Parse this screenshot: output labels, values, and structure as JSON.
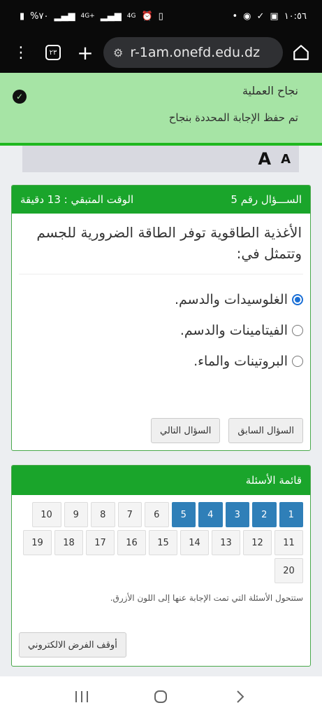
{
  "status_bar": {
    "left": "%٧٠",
    "time": "١٠:٥٦",
    "net1": "4G+",
    "net2": "4G"
  },
  "browser": {
    "tab_count": "٢٣",
    "url": "r-1am.onefd.edu.dz"
  },
  "toast": {
    "title": "نجاح العملية",
    "message": "تم حفظ الإجابة المحددة بنجاح"
  },
  "font_controls": {
    "large": "A",
    "small": "A"
  },
  "question": {
    "number_label": "الســـؤال رقم 5",
    "time_left": "الوقت المتبقي : 13 دقيقة",
    "text": "الأغذية الطاقوية توفر الطاقة الضرورية للجسم وتتمثل في:",
    "options": [
      {
        "label": "الغلوسيدات والدسم.",
        "selected": true
      },
      {
        "label": "الفيتامينات والدسم.",
        "selected": false
      },
      {
        "label": "البروتينات والماء.",
        "selected": false
      }
    ],
    "prev_label": "السؤال السابق",
    "next_label": "السؤال التالي"
  },
  "question_list": {
    "title": "قائمة الأسئلة",
    "row1": [
      "1",
      "2",
      "3",
      "4",
      "5",
      "6",
      "7",
      "8",
      "9",
      "10"
    ],
    "row2": [
      "11",
      "12",
      "13",
      "14",
      "15",
      "16",
      "17",
      "18",
      "19"
    ],
    "row3": [
      "20"
    ],
    "answered_count": 5,
    "note": "ستتحول الأسئلة التي تمت الإجابة عنها إلى اللون الأزرق.",
    "stop_label": "أوقف الفرض الالكتروني"
  },
  "colors": {
    "green": "#1aa52b",
    "answered": "#2f7fb8",
    "toast_bg": "#a6e4a5"
  }
}
